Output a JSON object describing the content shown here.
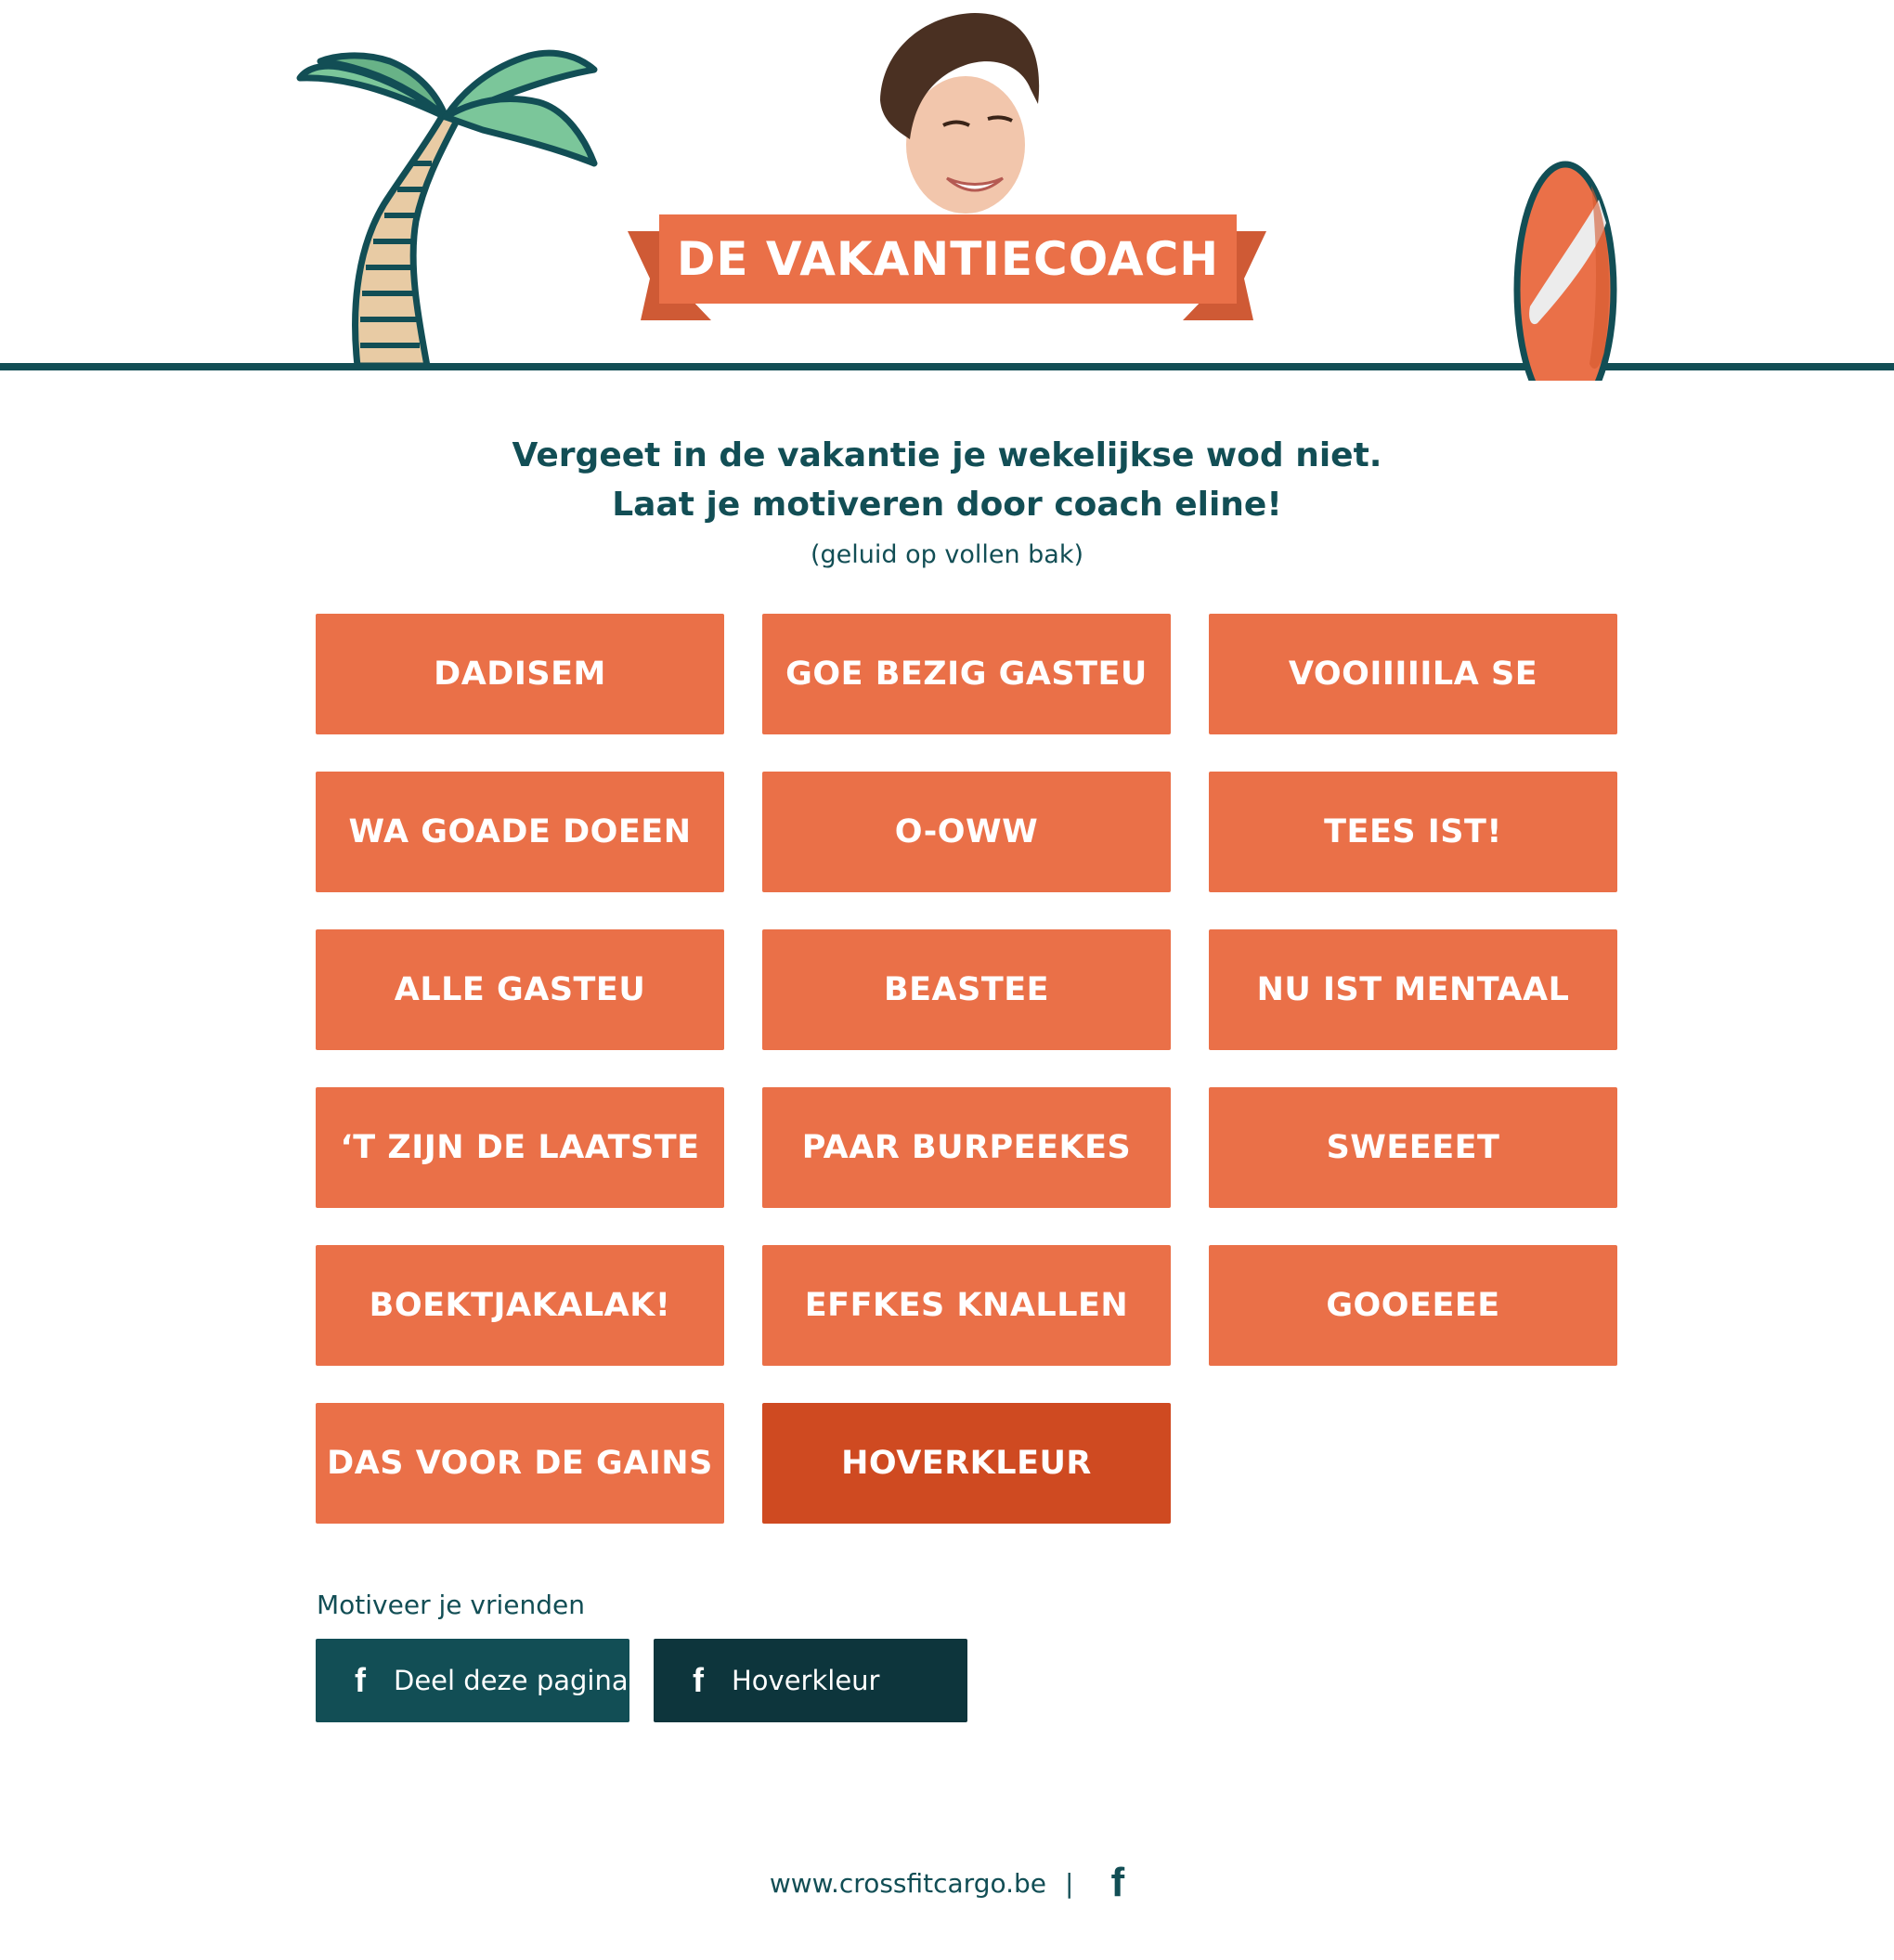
{
  "header": {
    "title": "DE VAKANTIECOACH"
  },
  "intro": {
    "line1": "Vergeet in de vakantie je wekelijkse wod niet.",
    "line2": "Laat je motiveren door coach eline!",
    "note": "(geluid op vollen bak)"
  },
  "sounds": [
    {
      "label": "DADISEM"
    },
    {
      "label": "GOE BEZIG GASTEU"
    },
    {
      "label": "VOOIIIIILA SE"
    },
    {
      "label": "WA GOADE DOEEN"
    },
    {
      "label": "O-OWW"
    },
    {
      "label": "TEES IST!"
    },
    {
      "label": "ALLE GASTEU"
    },
    {
      "label": "BEASTEE"
    },
    {
      "label": "NU IST MENTAAL"
    },
    {
      "label": "‘T ZIJN DE LAATSTE"
    },
    {
      "label": "PAAR BURPEEKES"
    },
    {
      "label": "SWEEEET"
    },
    {
      "label": "BOEKTJAKALAK!"
    },
    {
      "label": "EFFKES KNALLEN"
    },
    {
      "label": "GOOEEEE"
    },
    {
      "label": "DAS VOOR DE GAINS"
    },
    {
      "label": "HOVERKLEUR"
    }
  ],
  "share": {
    "label": "Motiveer je vrienden",
    "button1": "Deel deze pagina",
    "button2": "Hoverkleur",
    "icon": "facebook-icon"
  },
  "footer": {
    "site": "www.crossfitcargo.be",
    "separator": "|",
    "icon": "facebook-icon"
  },
  "colors": {
    "accent": "#ea7048",
    "accent_hover": "#cf4a21",
    "dark": "#124e55",
    "dark_hover": "#0d353c"
  }
}
